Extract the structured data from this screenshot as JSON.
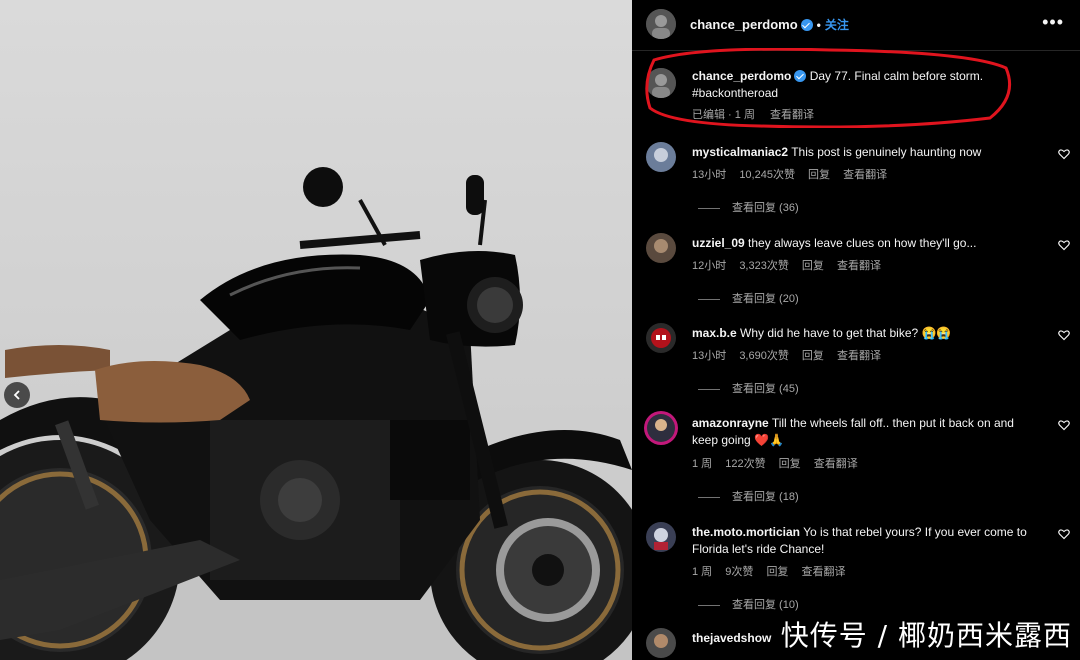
{
  "post": {
    "username": "chance_perdomo",
    "follow_label": "关注",
    "more_label": "•••",
    "caption_text": "Day 77. Final calm before storm. #backontheroad",
    "caption_meta_edited": "已编辑 · 1 周",
    "caption_meta_translate": "查看翻译"
  },
  "comments": [
    {
      "username": "mysticalmaniac2",
      "text": "This post is genuinely haunting now",
      "time": "13小时",
      "likes": "10,245次赞",
      "reply": "回复",
      "translate": "查看翻译",
      "view_replies": "查看回复 (36)"
    },
    {
      "username": "uzziel_09",
      "text": "they always leave clues on how they'll go...",
      "time": "12小时",
      "likes": "3,323次赞",
      "reply": "回复",
      "translate": "查看翻译",
      "view_replies": "查看回复 (20)"
    },
    {
      "username": "max.b.e",
      "text": "Why did he have to get that bike? 😭😭",
      "time": "13小时",
      "likes": "3,690次赞",
      "reply": "回复",
      "translate": "查看翻译",
      "view_replies": "查看回复 (45)"
    },
    {
      "username": "amazonrayne",
      "text": "Till the wheels fall off.. then put it back on and keep going ❤️🙏",
      "time": "1 周",
      "likes": "122次赞",
      "reply": "回复",
      "translate": "查看翻译",
      "view_replies": "查看回复 (18)"
    },
    {
      "username": "the.moto.mortician",
      "text": "Yo is that rebel yours? If you ever come to Florida let's ride Chance!",
      "time": "1 周",
      "likes": "9次赞",
      "reply": "回复",
      "translate": "查看翻译",
      "view_replies": "查看回复 (10)"
    },
    {
      "username": "thejavedshow",
      "text": ""
    }
  ],
  "watermark": "快传号 / 椰奶西米露西",
  "colors": {
    "accent": "#3897f0",
    "highlight": "#e0141e",
    "bg": "#000000"
  }
}
